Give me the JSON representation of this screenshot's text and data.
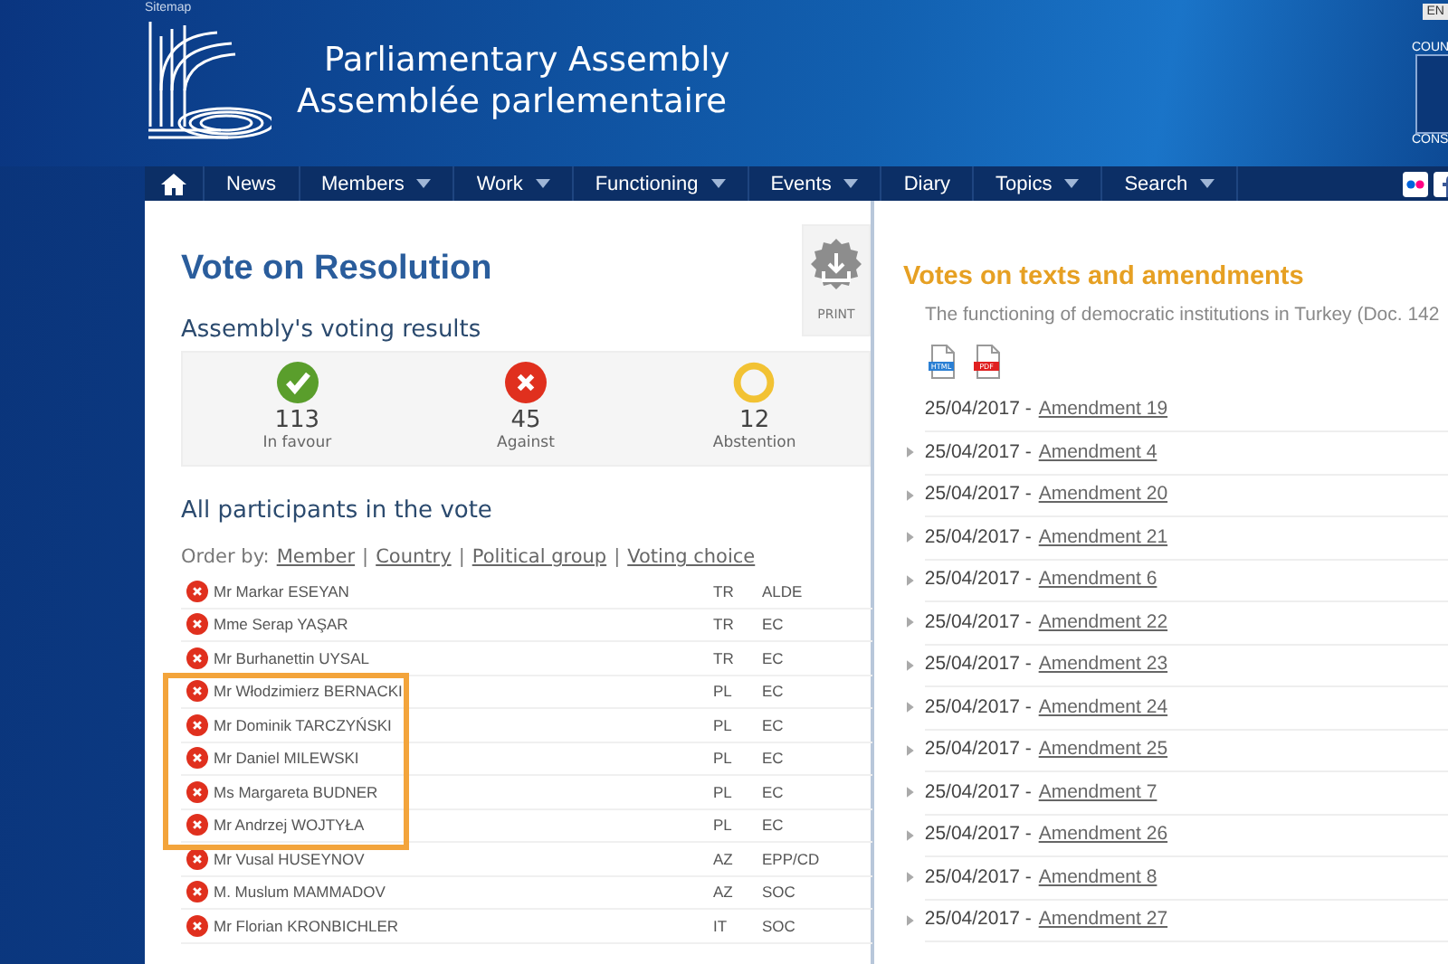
{
  "header": {
    "sitemap": "Sitemap",
    "title_en": "Parliamentary Assembly",
    "title_fr": "Assemblée parlementaire",
    "language": "EN",
    "side_top": "COUN",
    "side_bottom": "CONS"
  },
  "nav": [
    {
      "label": "News",
      "dropdown": false
    },
    {
      "label": "Members",
      "dropdown": true
    },
    {
      "label": "Work",
      "dropdown": true
    },
    {
      "label": "Functioning",
      "dropdown": true
    },
    {
      "label": "Events",
      "dropdown": true
    },
    {
      "label": "Diary",
      "dropdown": false
    },
    {
      "label": "Topics",
      "dropdown": true
    },
    {
      "label": "Search",
      "dropdown": true
    }
  ],
  "left": {
    "title": "Vote on Resolution",
    "print": "PRINT",
    "results_title": "Assembly's voting results",
    "results": [
      {
        "kind": "for",
        "count": "113",
        "label": "In favour"
      },
      {
        "kind": "against",
        "count": "45",
        "label": "Against"
      },
      {
        "kind": "abstention",
        "count": "12",
        "label": "Abstention"
      }
    ],
    "participants_title": "All participants in the vote",
    "order_by": "Order by:",
    "order_separator": "|",
    "order_links": [
      "Member",
      "Country",
      "Political group",
      "Voting choice"
    ],
    "participants": [
      {
        "kind": "against",
        "name": "Mr Markar ESEYAN",
        "country": "TR",
        "group": "ALDE",
        "highlighted": false
      },
      {
        "kind": "against",
        "name": "Mme Serap YAŞAR",
        "country": "TR",
        "group": "EC",
        "highlighted": false
      },
      {
        "kind": "against",
        "name": "Mr Burhanettin UYSAL",
        "country": "TR",
        "group": "EC",
        "highlighted": false
      },
      {
        "kind": "against",
        "name": "Mr Włodzimierz BERNACKI",
        "country": "PL",
        "group": "EC",
        "highlighted": true
      },
      {
        "kind": "against",
        "name": "Mr Dominik TARCZYŃSKI",
        "country": "PL",
        "group": "EC",
        "highlighted": true
      },
      {
        "kind": "against",
        "name": "Mr Daniel MILEWSKI",
        "country": "PL",
        "group": "EC",
        "highlighted": true
      },
      {
        "kind": "against",
        "name": "Ms Margareta BUDNER",
        "country": "PL",
        "group": "EC",
        "highlighted": true
      },
      {
        "kind": "against",
        "name": "Mr Andrzej WOJTYŁA",
        "country": "PL",
        "group": "EC",
        "highlighted": true
      },
      {
        "kind": "against",
        "name": "Mr Vusal HUSEYNOV",
        "country": "AZ",
        "group": "EPP/CD",
        "highlighted": false
      },
      {
        "kind": "against",
        "name": "M. Muslum MAMMADOV",
        "country": "AZ",
        "group": "SOC",
        "highlighted": false
      },
      {
        "kind": "against",
        "name": "Mr Florian KRONBICHLER",
        "country": "IT",
        "group": "SOC",
        "highlighted": false
      }
    ]
  },
  "right": {
    "title": "Votes on texts and amendments",
    "document": "The functioning of democratic institutions in Turkey (Doc. 142",
    "downloads": [
      {
        "kind": "html",
        "label": "HTML"
      },
      {
        "kind": "pdf",
        "label": "PDF"
      }
    ],
    "votes": [
      {
        "date": "25/04/2017 -",
        "link": "Amendment 19",
        "arrow": false
      },
      {
        "date": "25/04/2017 -",
        "link": "Amendment 4",
        "arrow": true
      },
      {
        "date": "25/04/2017 -",
        "link": "Amendment 20",
        "arrow": true
      },
      {
        "date": "25/04/2017 -",
        "link": "Amendment 21",
        "arrow": true
      },
      {
        "date": "25/04/2017 -",
        "link": "Amendment 6",
        "arrow": true
      },
      {
        "date": "25/04/2017 -",
        "link": "Amendment 22",
        "arrow": true
      },
      {
        "date": "25/04/2017 -",
        "link": "Amendment 23",
        "arrow": true
      },
      {
        "date": "25/04/2017 -",
        "link": "Amendment 24",
        "arrow": true
      },
      {
        "date": "25/04/2017 -",
        "link": "Amendment 25",
        "arrow": true
      },
      {
        "date": "25/04/2017 -",
        "link": "Amendment 7",
        "arrow": true
      },
      {
        "date": "25/04/2017 -",
        "link": "Amendment 26",
        "arrow": true
      },
      {
        "date": "25/04/2017 -",
        "link": "Amendment 8",
        "arrow": true
      },
      {
        "date": "25/04/2017 -",
        "link": "Amendment 27",
        "arrow": true
      }
    ]
  }
}
